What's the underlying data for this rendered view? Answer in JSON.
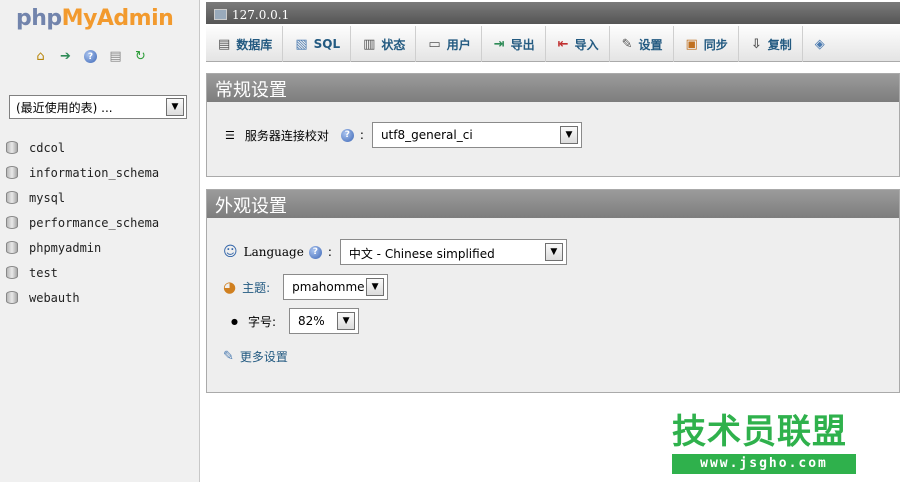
{
  "app": {
    "logo_php": "php",
    "logo_myadmin": "MyAdmin"
  },
  "sidebar": {
    "quick_icons": [
      "home-icon",
      "exit-icon",
      "help-icon",
      "docs-icon",
      "reload-icon"
    ],
    "recent_tables": "(最近使用的表) ...",
    "databases": [
      "cdcol",
      "information_schema",
      "mysql",
      "performance_schema",
      "phpmyadmin",
      "test",
      "webauth"
    ]
  },
  "server": {
    "host": "127.0.0.1"
  },
  "tabs": [
    {
      "label": "数据库",
      "icon": "database-icon"
    },
    {
      "label": "SQL",
      "icon": "sql-icon"
    },
    {
      "label": "状态",
      "icon": "status-icon"
    },
    {
      "label": "用户",
      "icon": "users-icon"
    },
    {
      "label": "导出",
      "icon": "export-icon"
    },
    {
      "label": "导入",
      "icon": "import-icon"
    },
    {
      "label": "设置",
      "icon": "settings-icon"
    },
    {
      "label": "同步",
      "icon": "sync-icon"
    },
    {
      "label": "复制",
      "icon": "replication-icon"
    }
  ],
  "general": {
    "title": "常规设置",
    "collation_label": "服务器连接校对",
    "collation_value": "utf8_general_ci"
  },
  "appearance": {
    "title": "外观设置",
    "language_label": "Language",
    "language_value": "中文 - Chinese simplified",
    "theme_label": "主题:",
    "theme_value": "pmahomme",
    "fontsize_label": "字号:",
    "fontsize_value": "82%",
    "more_settings": "更多设置"
  },
  "watermark": {
    "title": "技术员联盟",
    "url": "www.jsgho.com"
  },
  "colors": {
    "link": "#235a81",
    "panel_header": "#8a8a8a",
    "watermark": "#2fb14c"
  }
}
